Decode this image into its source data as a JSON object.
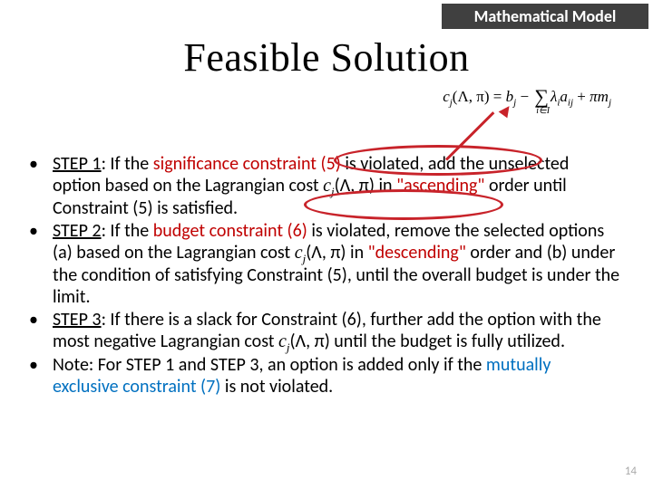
{
  "header": {
    "label": "Mathematical Model"
  },
  "title": "Feasible Solution",
  "formula": {
    "lhs_var": "c",
    "lhs_sub": "j",
    "lhs_args": "(Λ, π)",
    "eq": " = ",
    "b": "b",
    "b_sub": "j",
    "minus": " − ",
    "sigma_sub": "i∈I",
    "lambda": "λ",
    "lambda_sub": "i",
    "a": "a",
    "a_sub": "ij",
    "plus": " + ",
    "pi": "π",
    "m": "m",
    "m_sub": "j"
  },
  "bullets": [
    {
      "step_label": "STEP 1",
      "pre": ": If the ",
      "hl1": "significance constraint (5)",
      "mid1": " is violated, add the unselected option based on the Lagrangian cost ",
      "cost_var": "c",
      "cost_sub": "j",
      "cost_args": "(Λ, π)",
      "mid2": " in ",
      "hl2": "\"ascending\"",
      "tail": " order until Constraint (5) is satisfied."
    },
    {
      "step_label": "STEP 2",
      "pre": ": If the ",
      "hl1": "budget constraint (6)",
      "mid1": " is violated, remove the selected options (a) based on the Lagrangian cost ",
      "cost_var": "c",
      "cost_sub": "j",
      "cost_args": "(Λ, π)",
      "mid2": " in ",
      "hl2": "\"descending\"",
      "tail": " order and (b) under the condition of satisfying Constraint (5), until the overall budget is under the limit."
    },
    {
      "step_label": "STEP 3",
      "pre": ": If there is a slack for Constraint (6), further add the option with the most negative Lagrangian cost ",
      "cost_var": "c",
      "cost_sub": "j",
      "cost_args": "(Λ, π)",
      "tail": " until the budget is fully utilized."
    },
    {
      "note_pre": "Note: For STEP 1 and STEP 3, an option is added only if the ",
      "note_hl": "mutually exclusive constraint (7)",
      "note_tail": " is not violated."
    }
  ],
  "page_number": "14",
  "annotations": {
    "ellipse_color": "#c8232a"
  }
}
